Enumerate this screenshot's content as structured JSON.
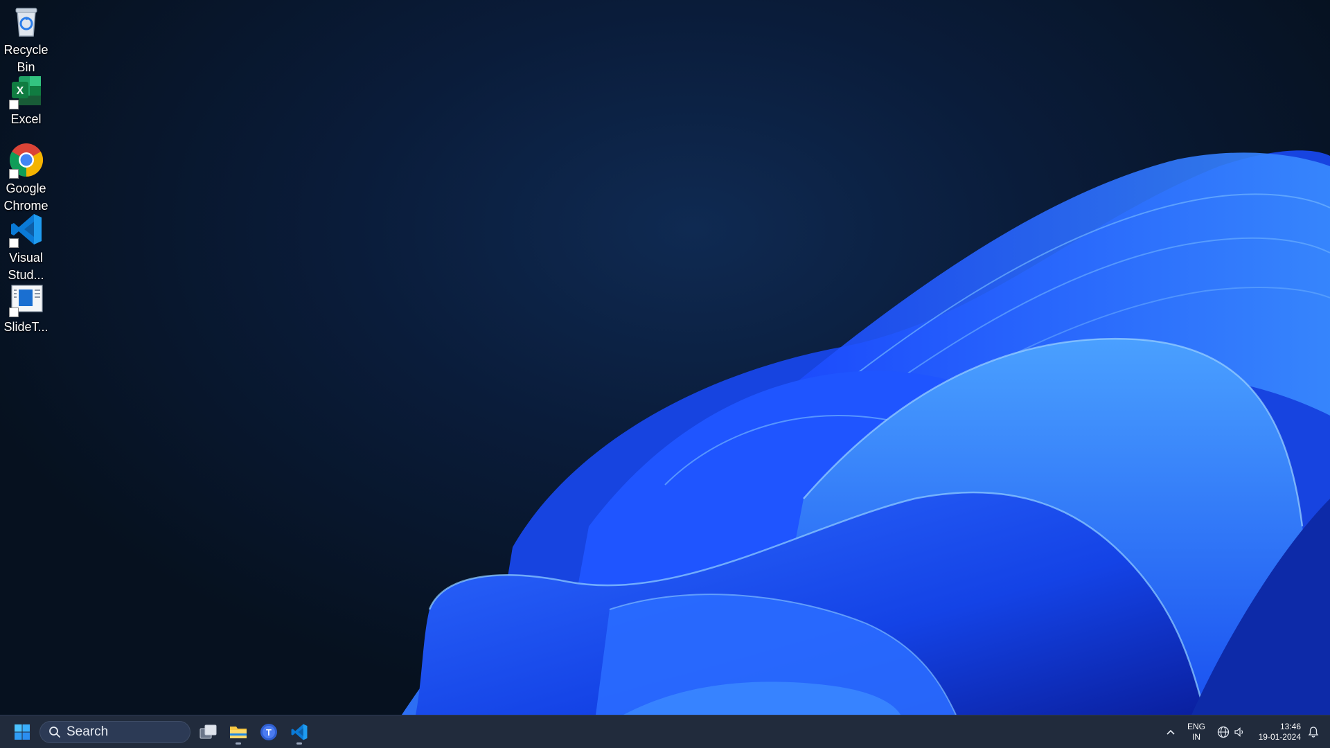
{
  "desktop": {
    "icons": [
      {
        "label": "Recycle Bin",
        "icon": "recycle-bin-icon"
      },
      {
        "label": "Excel",
        "icon": "excel-icon"
      },
      {
        "label": "Google Chrome",
        "icon": "chrome-icon"
      },
      {
        "label": "Visual Stud...",
        "icon": "vscode-icon"
      },
      {
        "label": "SlideT...",
        "icon": "slide-app-icon"
      }
    ]
  },
  "taskbar": {
    "search_label": "Search",
    "apps": [
      {
        "name": "Task View",
        "icon": "task-view-icon"
      },
      {
        "name": "File Explorer",
        "icon": "file-explorer-icon"
      },
      {
        "name": "Teams",
        "icon": "teams-icon"
      },
      {
        "name": "Visual Studio Code",
        "icon": "vscode-icon"
      }
    ],
    "tray": {
      "language": "ENG",
      "region": "IN",
      "time": "13:46",
      "date": "19-01-2024"
    }
  },
  "colors": {
    "accent": "#1a5cff",
    "taskbar_bg": "#182234",
    "wallpaper_dark": "#06111f"
  }
}
